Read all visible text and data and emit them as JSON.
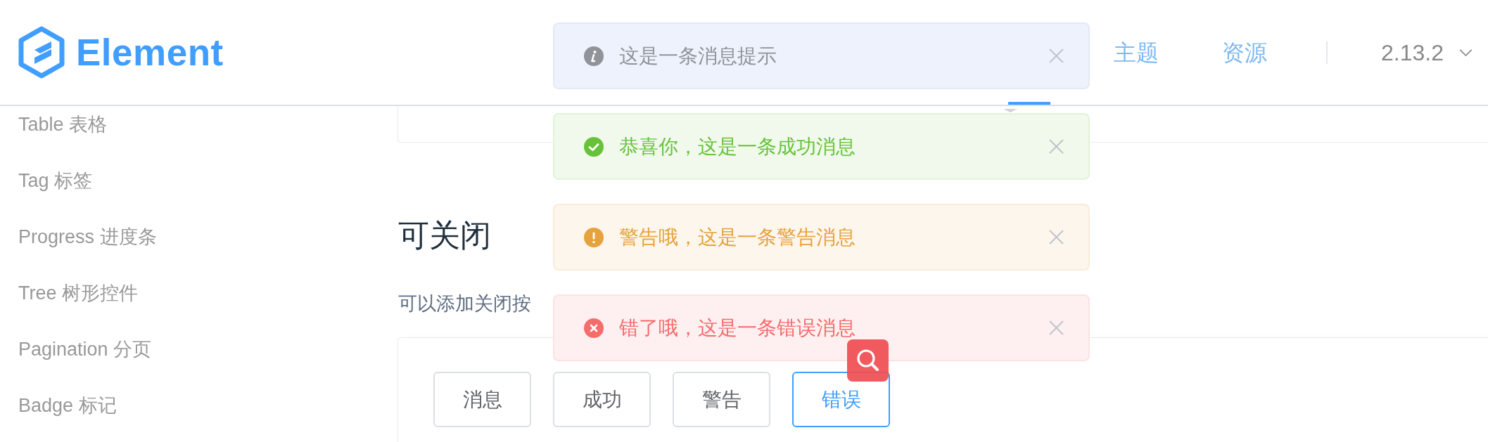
{
  "header": {
    "logo_text": "Element",
    "active_underline": true,
    "nav": [
      {
        "label": "主题",
        "selected": false
      },
      {
        "label": "资源",
        "selected": false
      }
    ],
    "version": "2.13.2"
  },
  "sidebar": {
    "items": [
      {
        "label": "Table 表格",
        "selected": false
      },
      {
        "label": "Tag 标签",
        "selected": false
      },
      {
        "label": "Progress 进度条",
        "selected": false
      },
      {
        "label": "Tree 树形控件",
        "selected": false
      },
      {
        "label": "Pagination 分页",
        "selected": false
      },
      {
        "label": "Badge 标记",
        "selected": false
      }
    ]
  },
  "content": {
    "heading": "可关闭",
    "description": "可以添加关闭按",
    "buttons": [
      {
        "label": "消息",
        "focused": false
      },
      {
        "label": "成功",
        "focused": false
      },
      {
        "label": "警告",
        "focused": false
      },
      {
        "label": "错误",
        "focused": true
      }
    ]
  },
  "messages": [
    {
      "kind": "info",
      "text": "这是一条消息提示",
      "closable": true
    },
    {
      "kind": "success",
      "text": "恭喜你，这是一条成功消息",
      "closable": true
    },
    {
      "kind": "warning",
      "text": "警告哦，这是一条警告消息",
      "closable": true
    },
    {
      "kind": "error",
      "text": "错了哦，这是一条错误消息",
      "closable": true
    }
  ]
}
